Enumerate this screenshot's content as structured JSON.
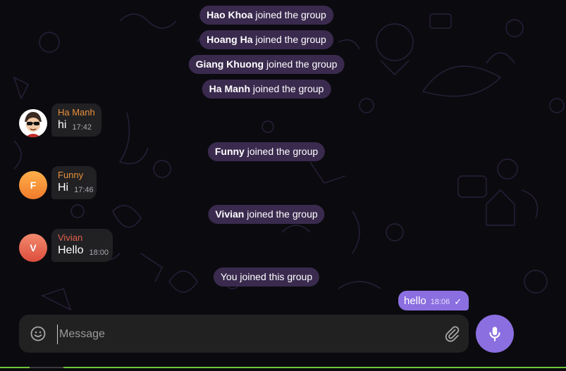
{
  "system_messages": [
    {
      "name": "Hao Khoa",
      "action": "joined the group"
    },
    {
      "name": "Hoang Ha",
      "action": "joined the group"
    },
    {
      "name": "Giang Khuong",
      "action": "joined the group"
    },
    {
      "name": "Ha Manh",
      "action": "joined the group"
    },
    {
      "name": "Funny",
      "action": "joined the group"
    },
    {
      "name": "Vivian",
      "action": "joined the group"
    },
    {
      "name": "",
      "action": "You joined this group"
    }
  ],
  "messages": [
    {
      "sender": "Ha Manh",
      "text": "hi",
      "time": "17:42",
      "sender_color": "#e8903a",
      "avatar_icon": "cartoon-avatar-icon"
    },
    {
      "sender": "Funny",
      "text": "Hi",
      "time": "17:46",
      "sender_color": "#e8903a",
      "avatar_letter": "F"
    },
    {
      "sender": "Vivian",
      "text": "Hello",
      "time": "18:00",
      "sender_color": "#e0604c",
      "avatar_letter": "V"
    }
  ],
  "outgoing": {
    "text": "hello",
    "time": "18:06",
    "status_icon": "check-icon"
  },
  "composer": {
    "placeholder": "Message",
    "emoji_icon": "smiley-icon",
    "attach_icon": "paperclip-icon",
    "send_icon": "microphone-icon"
  },
  "colors": {
    "accent": "#8b6fe0",
    "system_bubble": "#3a2a4e",
    "incoming_bubble": "#212124",
    "background": "#0b0b0f"
  }
}
